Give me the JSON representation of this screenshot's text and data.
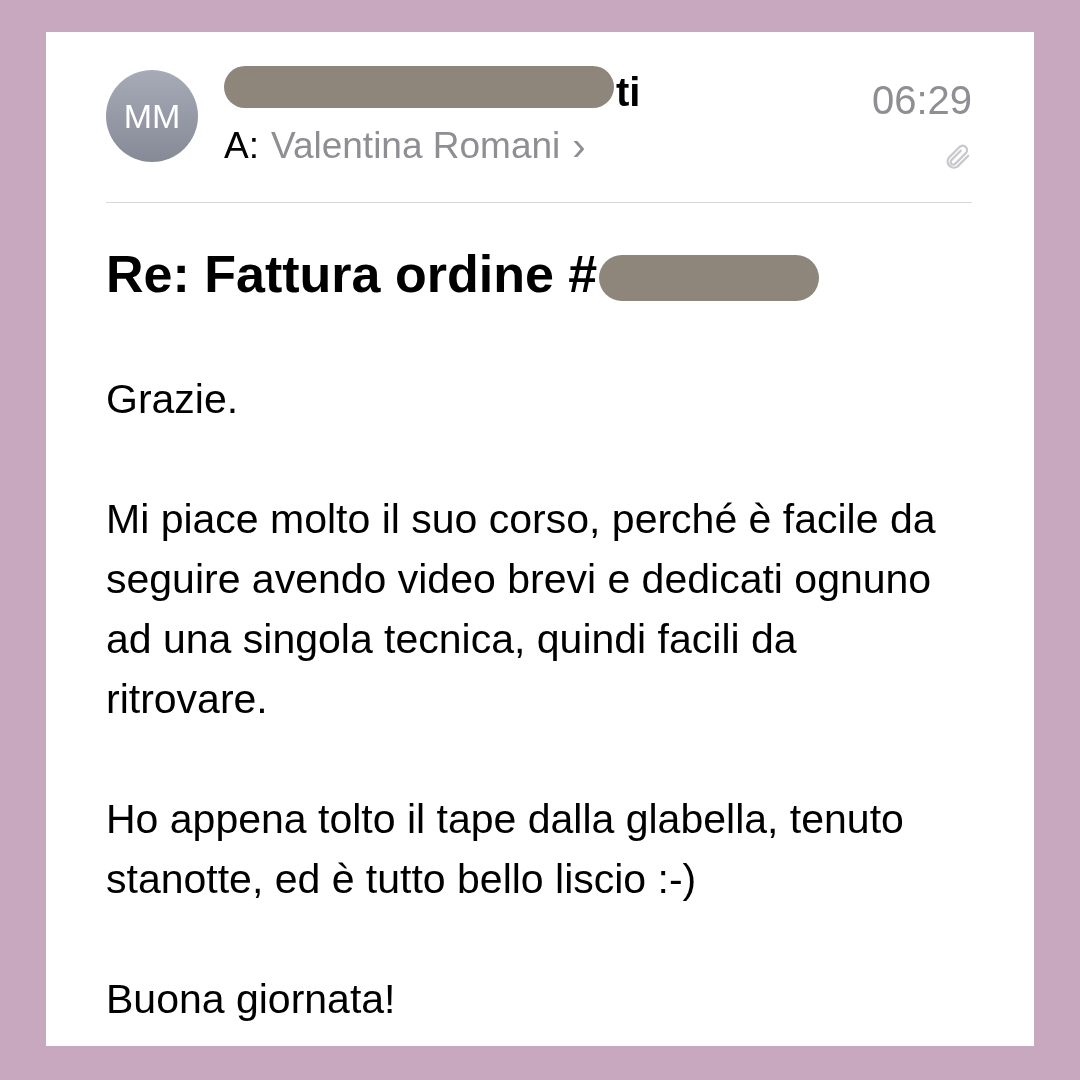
{
  "sender": {
    "initials": "MM",
    "name_visible": "ti",
    "redacted": true
  },
  "recipient": {
    "label": "A:",
    "name": "Valentina Romani",
    "chevron": "›"
  },
  "time": "06:29",
  "has_attachment": true,
  "subject": {
    "text": "Re: Fattura ordine #",
    "redacted": true
  },
  "body": [
    "Grazie.",
    "Mi piace molto il suo corso, perché è facile da seguire avendo video brevi e dedicati ognuno ad una singola tecnica, quindi facili da ritrovare.",
    "Ho appena tolto il tape dalla glabella, tenuto stanotte, ed è tutto bello liscio :-)",
    "Buona giornata!"
  ]
}
